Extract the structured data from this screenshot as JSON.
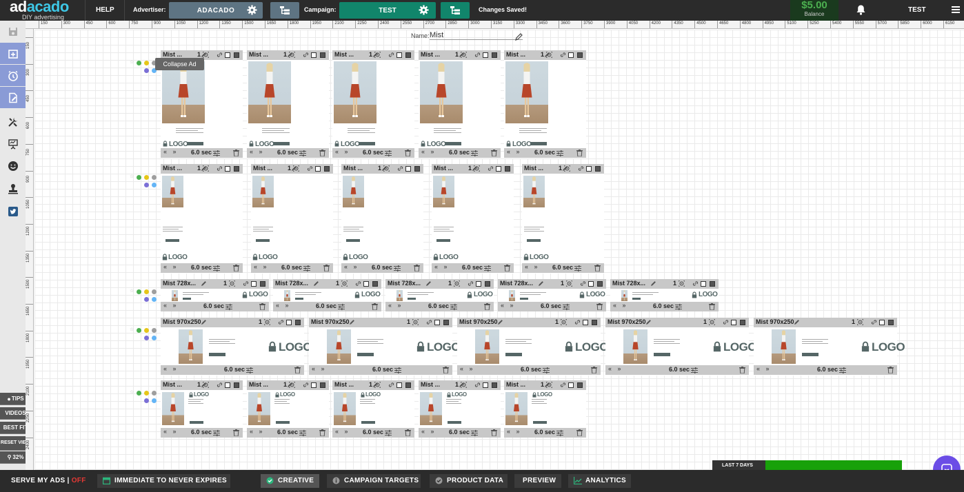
{
  "brand": {
    "name_a": "ad",
    "name_b": "acado",
    "tagline": "DIY advertising"
  },
  "topbar": {
    "help": "HELP",
    "advertiser_label": "Advertiser:",
    "advertiser_value": "ADACADO",
    "campaign_label": "Campaign:",
    "campaign_value": "TEST",
    "status": "Changes Saved!",
    "balance_amount": "$5.00",
    "balance_label": "Balance",
    "user": "TEST"
  },
  "colors": {
    "accent": "#11856b",
    "advertiser_btn": "#5e7483",
    "brand_blue": "#3ec7e6",
    "sidebar_active": "#8a9bd6",
    "balance_green": "#4caf50",
    "chat": "#6b4de6"
  },
  "ruler": {
    "top_labels": [
      "150",
      "300",
      "450",
      "600",
      "750",
      "900",
      "1050",
      "1200",
      "1350",
      "1500",
      "1650",
      "1800",
      "1950",
      "2100",
      "2250",
      "2400",
      "2550",
      "2700",
      "2850",
      "3000",
      "3150",
      "3300",
      "3450",
      "3600",
      "3750",
      "3900",
      "4050",
      "4200",
      "4350",
      "4500",
      "4650",
      "4800",
      "4950",
      "5100",
      "5250",
      "5400",
      "5550",
      "5700",
      "5850",
      "6000",
      "6150"
    ],
    "left_labels": [
      "150",
      "300",
      "450",
      "600",
      "750",
      "900",
      "1050",
      "1200",
      "1350",
      "1500",
      "1650",
      "1800",
      "1950",
      "2100",
      "2250",
      "2400"
    ]
  },
  "sidebar": {
    "icons": [
      "save-icon",
      "add-ad-icon",
      "clock-icon",
      "edit-doc-icon",
      "tools-icon",
      "presentation-icon",
      "smiley-icon",
      "stamp-icon",
      "twitter-icon"
    ],
    "tips": "TIPS",
    "videos": "VIDEOS",
    "best_fit": "BEST FIT",
    "reset_view": "RESET VIEW",
    "zoom": "32%"
  },
  "canvas": {
    "name_label": "Name:",
    "name_value": "Mist",
    "tooltip": "Collapse Ad"
  },
  "ad_common": {
    "seconds": "6.0 sec",
    "count": "1",
    "logo_text": "LOGO",
    "arrows": "« »"
  },
  "rows": [
    {
      "label": "Mist ...",
      "type": "tall",
      "count": 5
    },
    {
      "label": "Mist ...",
      "type": "sky",
      "count": 5
    },
    {
      "label": "Mist 728x...",
      "type": "leader",
      "count": 5
    },
    {
      "label": "Mist 970x250",
      "type": "bill",
      "count": 5
    },
    {
      "label": "Mist ...",
      "type": "mid",
      "count": 5
    }
  ],
  "greenbar": {
    "label": "LAST 7 DAYS"
  },
  "bottombar": {
    "serve": "SERVE MY ADS |",
    "serve_state": "OFF",
    "expiry": "IMMEDIATE TO NEVER EXPIRES",
    "creative": "CREATIVE",
    "targets": "CAMPAIGN TARGETS",
    "product": "PRODUCT DATA",
    "preview": "PREVIEW",
    "analytics": "ANALYTICS"
  }
}
